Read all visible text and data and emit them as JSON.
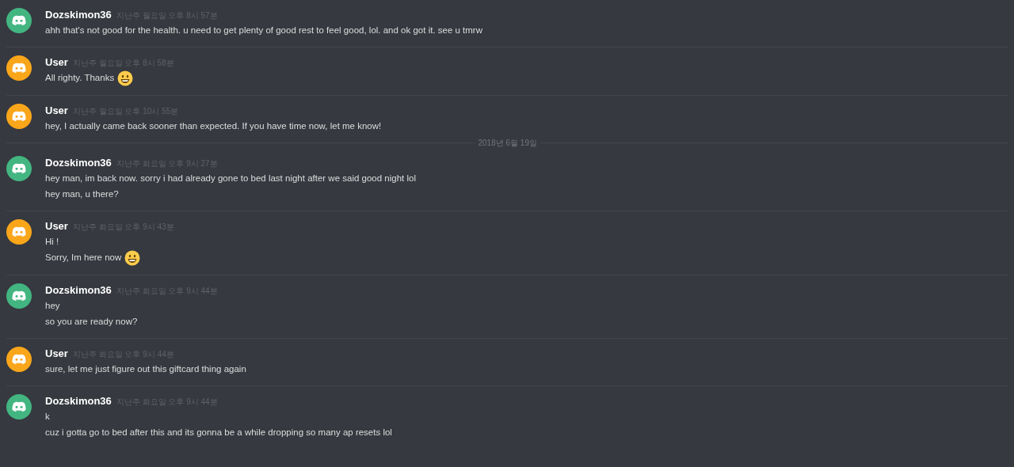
{
  "items": [
    {
      "kind": "message",
      "author": "Dozskimon36",
      "color": "#43b581",
      "timestamp": "지난주 월요일 오후 8시 57분",
      "lines": [
        {
          "text": "ahh that's not good for the health. u need to get plenty of good rest to feel good, lol. and ok got it. see u tmrw",
          "emoji": false
        }
      ]
    },
    {
      "kind": "message",
      "author": "User",
      "color": "#faa61a",
      "timestamp": "지난주 월요일 오후 8시 58분",
      "lines": [
        {
          "text": "All righty. Thanks",
          "emoji": true
        }
      ]
    },
    {
      "kind": "message",
      "author": "User",
      "color": "#faa61a",
      "timestamp": "지난주 월요일 오후 10시 55분",
      "lines": [
        {
          "text": "hey, I actually came back sooner than expected. If you have time now, let me know!",
          "emoji": false
        }
      ]
    },
    {
      "kind": "date_divider",
      "text": "2018년 6월 19일"
    },
    {
      "kind": "message",
      "author": "Dozskimon36",
      "color": "#43b581",
      "timestamp": "지난주 화요일 오후 9시 27분",
      "lines": [
        {
          "text": "hey man, im back now. sorry i had already gone to bed last night after we said good night lol",
          "emoji": false
        },
        {
          "text": "hey man, u there?",
          "emoji": false
        }
      ]
    },
    {
      "kind": "message",
      "author": "User",
      "color": "#faa61a",
      "timestamp": "지난주 화요일 오후 9시 43분",
      "lines": [
        {
          "text": "Hi !",
          "emoji": false
        },
        {
          "text": "Sorry, Im here now",
          "emoji": true
        }
      ]
    },
    {
      "kind": "message",
      "author": "Dozskimon36",
      "color": "#43b581",
      "timestamp": "지난주 화요일 오후 9시 44분",
      "lines": [
        {
          "text": "hey",
          "emoji": false
        },
        {
          "text": "so you are ready now?",
          "emoji": false
        }
      ]
    },
    {
      "kind": "message",
      "author": "User",
      "color": "#faa61a",
      "timestamp": "지난주 화요일 오후 9시 44분",
      "lines": [
        {
          "text": "sure, let me just figure out this giftcard thing again",
          "emoji": false
        }
      ]
    },
    {
      "kind": "message",
      "author": "Dozskimon36",
      "color": "#43b581",
      "timestamp": "지난주 화요일 오후 9시 44분",
      "lines": [
        {
          "text": "k",
          "emoji": false
        },
        {
          "text": "cuz i gotta go to bed after this and its gonna be a while dropping so many ap resets lol",
          "emoji": false
        }
      ]
    }
  ]
}
